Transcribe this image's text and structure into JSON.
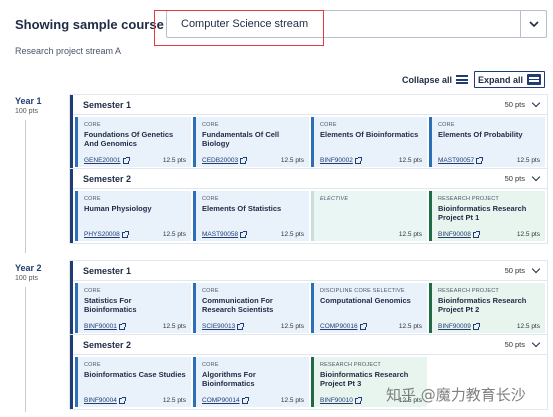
{
  "header": {
    "label": "Showing sample course plan:",
    "selected_plan": "Computer Science stream",
    "subtitle": "Research project stream A"
  },
  "controls": {
    "collapse_label": "Collapse all",
    "expand_label": "Expand all"
  },
  "years": [
    {
      "label": "Year 1",
      "points": "100 pts"
    },
    {
      "label": "Year 2",
      "points": "100 pts"
    }
  ],
  "semesters": [
    {
      "title": "Semester 1",
      "points": "50 pts",
      "cards": [
        {
          "category": "CORE",
          "title": "Foundations Of Genetics And Genomics",
          "code": "GENE20001",
          "points": "12.5 pts",
          "type": "core"
        },
        {
          "category": "CORE",
          "title": "Fundamentals Of Cell Biology",
          "code": "CEDB20003",
          "points": "12.5 pts",
          "type": "core"
        },
        {
          "category": "CORE",
          "title": "Elements Of Bioinformatics",
          "code": "BINF90002",
          "points": "12.5 pts",
          "type": "core"
        },
        {
          "category": "CORE",
          "title": "Elements Of Probability",
          "code": "MAST90057",
          "points": "12.5 pts",
          "type": "core"
        }
      ]
    },
    {
      "title": "Semester 2",
      "points": "50 pts",
      "cards": [
        {
          "category": "CORE",
          "title": "Human Physiology",
          "code": "PHYS20008",
          "points": "12.5 pts",
          "type": "core"
        },
        {
          "category": "CORE",
          "title": "Elements Of Statistics",
          "code": "MAST90058",
          "points": "12.5 pts",
          "type": "core"
        },
        {
          "category": "ELECTIVE",
          "title": "",
          "code": "",
          "points": "12.5 pts",
          "type": "elective"
        },
        {
          "category": "RESEARCH PROJECT",
          "title": "Bioinformatics Research Project Pt 1",
          "code": "BINF90008",
          "points": "12.5 pts",
          "type": "research"
        }
      ]
    },
    {
      "title": "Semester 1",
      "points": "50 pts",
      "cards": [
        {
          "category": "CORE",
          "title": "Statistics For Bioinformatics",
          "code": "BINF90001",
          "points": "12.5 pts",
          "type": "core"
        },
        {
          "category": "CORE",
          "title": "Communication For Research Scientists",
          "code": "SCIE90013",
          "points": "12.5 pts",
          "type": "core"
        },
        {
          "category": "DISCIPLINE CORE SELECTIVE",
          "title": "Computational Genomics",
          "code": "COMP90016",
          "points": "12.5 pts",
          "type": "core"
        },
        {
          "category": "RESEARCH PROJECT",
          "title": "Bioinformatics Research Project Pt 2",
          "code": "BINF90009",
          "points": "12.5 pts",
          "type": "research"
        }
      ]
    },
    {
      "title": "Semester 2",
      "points": "50 pts",
      "cards": [
        {
          "category": "CORE",
          "title": "Bioinformatics Case Studies",
          "code": "BINF90004",
          "points": "12.5 pts",
          "type": "core"
        },
        {
          "category": "CORE",
          "title": "Algorithms For Bioinformatics",
          "code": "COMP90014",
          "points": "12.5 pts",
          "type": "core"
        },
        {
          "category": "RESEARCH PROJECT",
          "title": "Bioinformatics Research Project Pt 3",
          "code": "BINF90010",
          "points": "12.5 pts",
          "type": "research"
        },
        {
          "category": "",
          "title": "",
          "code": "",
          "points": "",
          "type": "empty"
        }
      ]
    }
  ],
  "watermark": "知乎 @魔力教育长沙",
  "colors": {
    "brand": "#1f3d73",
    "core_bg": "#e9f1fb",
    "research_border": "#1f6b45",
    "highlight": "#e0393e"
  }
}
